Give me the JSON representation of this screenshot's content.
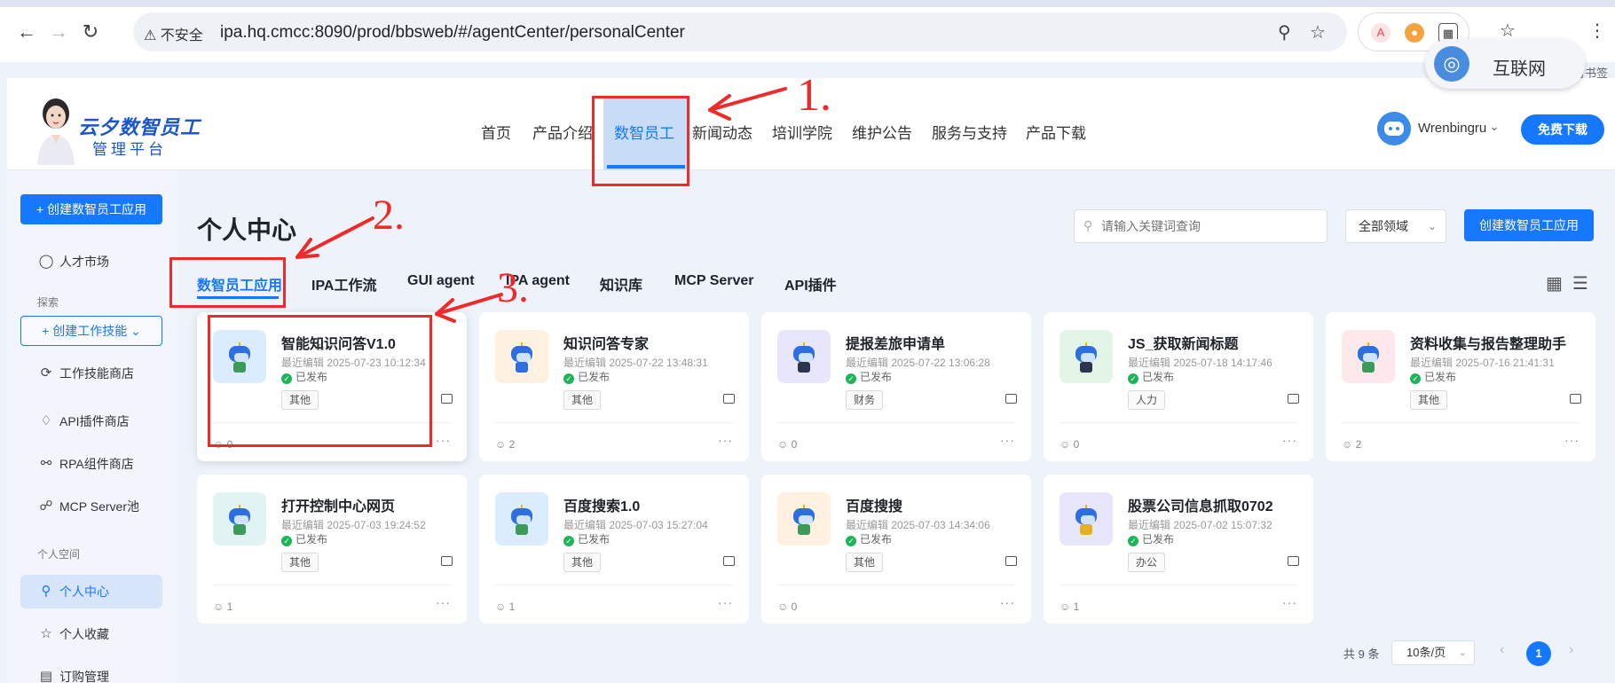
{
  "browser": {
    "security_label": "不安全",
    "url": "ipa.hq.cmcc:8090/prod/bbsweb/#/agentCenter/personalCenter",
    "badge_text": "互联网",
    "bookmark_hint": "所有书签"
  },
  "site": {
    "logo_title": "云夕数智员工",
    "logo_subtitle": "管理平台",
    "nav": [
      "首页",
      "产品介绍",
      "数智员工",
      "新闻动态",
      "培训学院",
      "维护公告",
      "服务与支持",
      "产品下载"
    ],
    "active_nav": "数智员工",
    "username": "Wrenbingru",
    "download_label": "免费下载"
  },
  "sidebar": {
    "create_button": "+ 创建数智员工应用",
    "market": "人才市场",
    "section_explore": "探索",
    "create_skill": "+ 创建工作技能",
    "skill_store": "工作技能商店",
    "api_store": "API插件商店",
    "rpa_store": "RPA组件商店",
    "mcp_pool": "MCP Server池",
    "section_personal": "个人空间",
    "personal_center": "个人中心",
    "favorites": "个人收藏",
    "orders": "订购管理"
  },
  "main": {
    "title": "个人中心",
    "search_placeholder": "请输入关键词查询",
    "domain_select": "全部领域",
    "create_button": "创建数智员工应用",
    "tabs": [
      "数智员工应用",
      "IPA工作流",
      "GUI agent",
      "IPA agent",
      "知识库",
      "MCP Server",
      "API插件"
    ],
    "active_tab": "数智员工应用",
    "status_label": "已发布",
    "cards": [
      {
        "name": "智能知识问答V1.0",
        "edited": "最近编辑 2025-07-23 10:12:34",
        "tag": "其他",
        "users": "0",
        "accent": "#dcecff",
        "body_color": "#3d9b5a"
      },
      {
        "name": "知识问答专家",
        "edited": "最近编辑 2025-07-22 13:48:31",
        "tag": "其他",
        "users": "2",
        "accent": "#fff0e0",
        "body_color": "#2e6fe0"
      },
      {
        "name": "提报差旅申请单",
        "edited": "最近编辑 2025-07-22 13:06:28",
        "tag": "财务",
        "users": "0",
        "accent": "#e7e6fb",
        "body_color": "#2b3550"
      },
      {
        "name": "JS_获取新闻标题",
        "edited": "最近编辑 2025-07-18 14:17:46",
        "tag": "人力",
        "users": "0",
        "accent": "#e3f5e6",
        "body_color": "#2b3550"
      },
      {
        "name": "资料收集与报告整理助手",
        "edited": "最近编辑 2025-07-16 21:41:31",
        "tag": "其他",
        "users": "2",
        "accent": "#fde9ec",
        "body_color": "#3d9b5a"
      },
      {
        "name": "打开控制中心网页",
        "edited": "最近编辑 2025-07-03 19:24:52",
        "tag": "其他",
        "users": "1",
        "accent": "#e1f4f3",
        "body_color": "#3d9b5a"
      },
      {
        "name": "百度搜索1.0",
        "edited": "最近编辑 2025-07-03 15:27:04",
        "tag": "其他",
        "users": "1",
        "accent": "#dcecff",
        "body_color": "#3d9b5a"
      },
      {
        "name": "百度搜搜",
        "edited": "最近编辑 2025-07-03 14:34:06",
        "tag": "其他",
        "users": "0",
        "accent": "#fff0e0",
        "body_color": "#3d9b5a"
      },
      {
        "name": "股票公司信息抓取0702",
        "edited": "最近编辑 2025-07-02 15:07:32",
        "tag": "办公",
        "users": "1",
        "accent": "#e7e6fb",
        "body_color": "#e5b021"
      }
    ],
    "pager": {
      "total": "共 9 条",
      "page_size": "10条/页",
      "current": "1"
    }
  },
  "annotations": [
    "1.",
    "2.",
    "3."
  ],
  "colors": {
    "primary": "#1677ff",
    "annotation": "#f02a2a",
    "published": "#1db45a"
  }
}
